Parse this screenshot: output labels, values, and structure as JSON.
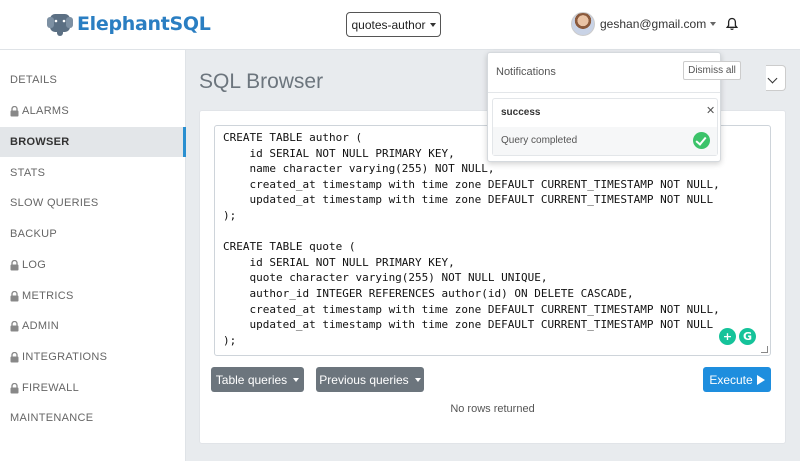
{
  "header": {
    "brand": "ElephantSQL",
    "instance": "quotes-author",
    "user_email": "geshan@gmail.com"
  },
  "sidebar": {
    "items": [
      {
        "label": "DETAILS",
        "locked": false,
        "active": false
      },
      {
        "label": "ALARMS",
        "locked": true,
        "active": false
      },
      {
        "label": "BROWSER",
        "locked": false,
        "active": true
      },
      {
        "label": "STATS",
        "locked": false,
        "active": false
      },
      {
        "label": "SLOW QUERIES",
        "locked": false,
        "active": false
      },
      {
        "label": "BACKUP",
        "locked": false,
        "active": false
      },
      {
        "label": "LOG",
        "locked": true,
        "active": false
      },
      {
        "label": "METRICS",
        "locked": true,
        "active": false
      },
      {
        "label": "ADMIN",
        "locked": true,
        "active": false
      },
      {
        "label": "INTEGRATIONS",
        "locked": true,
        "active": false
      },
      {
        "label": "FIREWALL",
        "locked": true,
        "active": false
      },
      {
        "label": "MAINTENANCE",
        "locked": false,
        "active": false
      }
    ]
  },
  "main": {
    "title": "SQL Browser",
    "query": "CREATE TABLE author (\n    id SERIAL NOT NULL PRIMARY KEY,\n    name character varying(255) NOT NULL,\n    created_at timestamp with time zone DEFAULT CURRENT_TIMESTAMP NOT NULL,\n    updated_at timestamp with time zone DEFAULT CURRENT_TIMESTAMP NOT NULL\n);\n\nCREATE TABLE quote (\n    id SERIAL NOT NULL PRIMARY KEY,\n    quote character varying(255) NOT NULL UNIQUE,\n    author_id INTEGER REFERENCES author(id) ON DELETE CASCADE,\n    created_at timestamp with time zone DEFAULT CURRENT_TIMESTAMP NOT NULL,\n    updated_at timestamp with time zone DEFAULT CURRENT_TIMESTAMP NOT NULL\n);",
    "table_queries_label": "Table queries",
    "previous_queries_label": "Previous queries",
    "execute_label": "Execute",
    "result_text": "No rows returned"
  },
  "notifications": {
    "title": "Notifications",
    "dismiss_label": "Dismiss all",
    "items": [
      {
        "type": "success",
        "message": "Query completed"
      }
    ]
  },
  "colors": {
    "brand": "#2a7ec2",
    "execute": "#1e8ede",
    "secondary_button": "#6c757d",
    "success": "#3cc36a"
  }
}
